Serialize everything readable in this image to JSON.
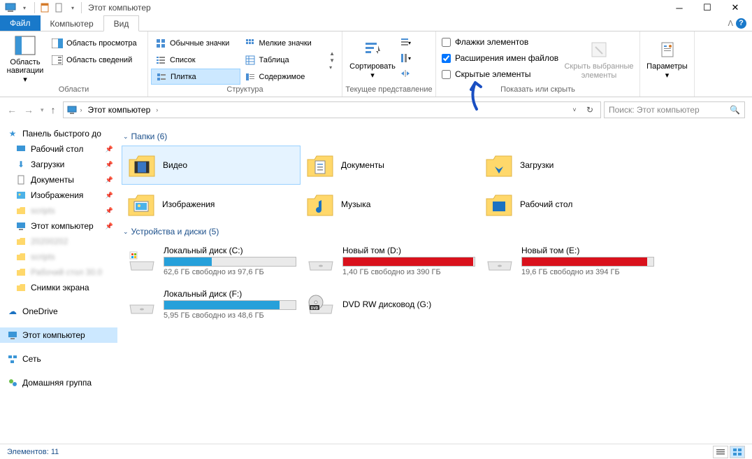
{
  "window": {
    "title": "Этот компьютер"
  },
  "tabs": {
    "file": "Файл",
    "computer": "Компьютер",
    "view": "Вид"
  },
  "ribbon": {
    "panes": {
      "nav_pane": "Область навигации",
      "preview_pane": "Область просмотра",
      "details_pane": "Область сведений",
      "group_panes": "Области"
    },
    "layout": {
      "regular_icons": "Обычные значки",
      "small_icons": "Мелкие значки",
      "list": "Список",
      "table": "Таблица",
      "tile": "Плитка",
      "content": "Содержимое",
      "group_layout": "Структура"
    },
    "currentview": {
      "sort": "Сортировать",
      "group_currentview": "Текущее представление"
    },
    "showhide": {
      "item_checkboxes": "Флажки элементов",
      "file_ext": "Расширения имен файлов",
      "hidden_items": "Скрытые элементы",
      "hide_selected": "Скрыть выбранные элементы",
      "group_showhide": "Показать или скрыть"
    },
    "options": {
      "label": "Параметры"
    }
  },
  "address": {
    "crumb_root": "Этот компьютер",
    "search_placeholder": "Поиск: Этот компьютер"
  },
  "sidebar": {
    "quick_access": "Панель быстрого до",
    "desktop": "Рабочий стол",
    "downloads": "Загрузки",
    "documents": "Документы",
    "pictures": "Изображения",
    "scripts1": "scripts",
    "this_pc_pin": "Этот компьютер",
    "d20": "20200202",
    "scripts2": "scripts",
    "desk30": "Рабочий стол 30.0",
    "screenshots": "Снимки экрана",
    "onedrive": "OneDrive",
    "this_pc": "Этот компьютер",
    "network": "Сеть",
    "homegroup": "Домашняя группа"
  },
  "groups": {
    "folders_hdr": "Папки (6)",
    "drives_hdr": "Устройства и диски (5)"
  },
  "folders": {
    "video": "Видео",
    "documents": "Документы",
    "downloads": "Загрузки",
    "pictures": "Изображения",
    "music": "Музыка",
    "desktop": "Рабочий стол"
  },
  "drives": {
    "c": {
      "name": "Локальный диск (C:)",
      "sub": "62,6 ГБ свободно из 97,6 ГБ",
      "fill": 36,
      "color": "#26a0da"
    },
    "d": {
      "name": "Новый том (D:)",
      "sub": "1,40 ГБ свободно из 390 ГБ",
      "fill": 99,
      "color": "#d9111c"
    },
    "e": {
      "name": "Новый том (E:)",
      "sub": "19,6 ГБ свободно из 394 ГБ",
      "fill": 95,
      "color": "#d9111c"
    },
    "f": {
      "name": "Локальный диск (F:)",
      "sub": "5,95 ГБ свободно из 48,6 ГБ",
      "fill": 88,
      "color": "#26a0da"
    },
    "g": {
      "name": "DVD RW дисковод (G:)",
      "sub": ""
    }
  },
  "status": {
    "items": "Элементов: 11"
  }
}
